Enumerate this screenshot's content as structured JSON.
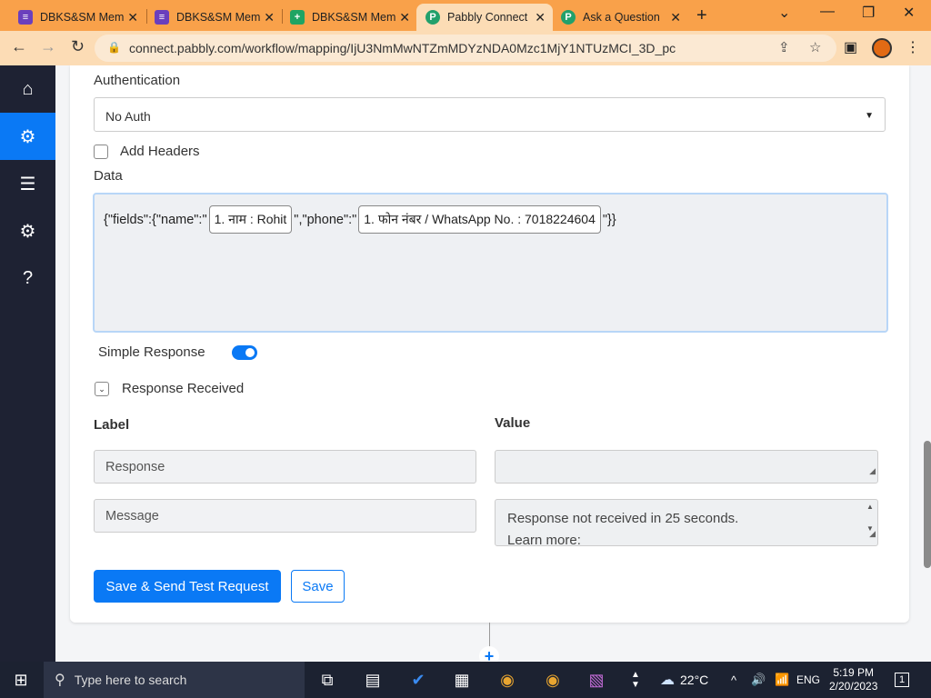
{
  "browser": {
    "tabs": [
      {
        "label": "DBKS&SM Mem",
        "icon": "forms-icon",
        "color": "#6a3fbd"
      },
      {
        "label": "DBKS&SM Mem",
        "icon": "forms-icon",
        "color": "#6a3fbd"
      },
      {
        "label": "DBKS&SM Mem",
        "icon": "sheets-icon",
        "color": "#1fa463"
      },
      {
        "label": "Pabbly Connect",
        "icon": "pabbly-icon",
        "color": "#22a06b"
      },
      {
        "label": "Ask a Question",
        "icon": "pabbly-icon",
        "color": "#22a06b"
      }
    ],
    "url": "connect.pabbly.com/workflow/mapping/IjU3NmMwNTZmMDYzNDA0Mzc1MjY1NTUzMCI_3D_pc"
  },
  "form": {
    "auth_label": "Authentication",
    "auth_value": "No Auth",
    "add_headers_label": "Add Headers",
    "data_label": "Data",
    "data": {
      "part1": "{\"fields\":{\"name\":\"",
      "pill1": "1. नाम : Rohit",
      "part2": "\",\"phone\":\"",
      "pill2": "1. फोन नंबर / WhatsApp No. : 7018224604",
      "part3": "\"}}"
    },
    "simple_response_label": "Simple Response",
    "response_received_label": "Response Received",
    "col_label": "Label",
    "col_value": "Value",
    "rows": [
      {
        "label": "Response",
        "value": ""
      },
      {
        "label": "Message",
        "value_line1": "Response not received in 25 seconds.",
        "value_line2": "Learn more:"
      }
    ],
    "save_send_label": "Save & Send Test Request",
    "save_label": "Save"
  },
  "taskbar": {
    "search_placeholder": "Type here to search",
    "weather": "22°C",
    "lang": "ENG",
    "time": "5:19 PM",
    "date": "2/20/2023",
    "notifications": "1"
  }
}
